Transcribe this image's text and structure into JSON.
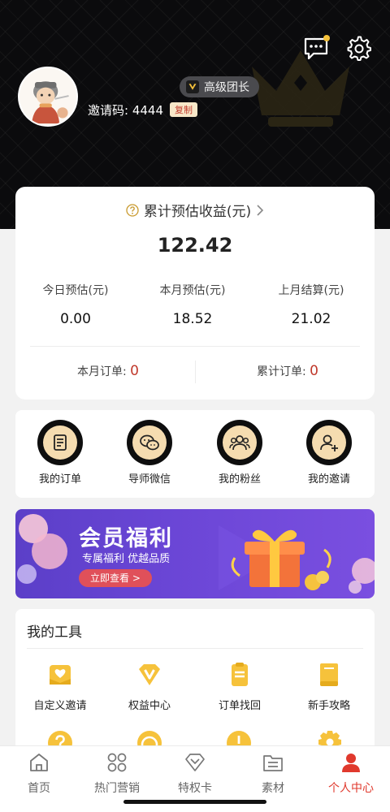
{
  "header": {
    "level_badge": "高级团长",
    "invite_label": "邀请码: 4444",
    "copy_label": "复制"
  },
  "earnings": {
    "title": "累计预估收益(元)",
    "total": "122.42",
    "stats": [
      {
        "label": "今日预估(元)",
        "value": "0.00"
      },
      {
        "label": "本月预估(元)",
        "value": "18.52"
      },
      {
        "label": "上月结算(元)",
        "value": "21.02"
      }
    ],
    "orders": [
      {
        "label": "本月订单:",
        "value": "0"
      },
      {
        "label": "累计订单:",
        "value": "0"
      }
    ]
  },
  "quick_actions": [
    {
      "label": "我的订单",
      "icon": "order-icon"
    },
    {
      "label": "导师微信",
      "icon": "wechat-icon"
    },
    {
      "label": "我的粉丝",
      "icon": "fans-icon"
    },
    {
      "label": "我的邀请",
      "icon": "invite-icon"
    }
  ],
  "banner": {
    "title": "会员福利",
    "subtitle": "专属福利 优越品质",
    "cta": "立即查看 >"
  },
  "tools": {
    "title": "我的工具",
    "items": [
      {
        "label": "自定义邀请",
        "icon": "custom-invite-icon"
      },
      {
        "label": "权益中心",
        "icon": "vip-diamond-icon"
      },
      {
        "label": "订单找回",
        "icon": "order-recover-icon"
      },
      {
        "label": "新手攻略",
        "icon": "guide-book-icon"
      }
    ]
  },
  "tabbar": [
    {
      "label": "首页",
      "icon": "home-icon"
    },
    {
      "label": "热门营销",
      "icon": "grid-icon"
    },
    {
      "label": "特权卡",
      "icon": "diamond-card-icon"
    },
    {
      "label": "素材",
      "icon": "materials-icon"
    },
    {
      "label": "个人中心",
      "icon": "profile-icon"
    }
  ],
  "colors": {
    "accent": "#e0392d",
    "gold": "#f6c23b",
    "header_bg": "#0b0b0d",
    "banner_purple": "#6b46d6"
  }
}
